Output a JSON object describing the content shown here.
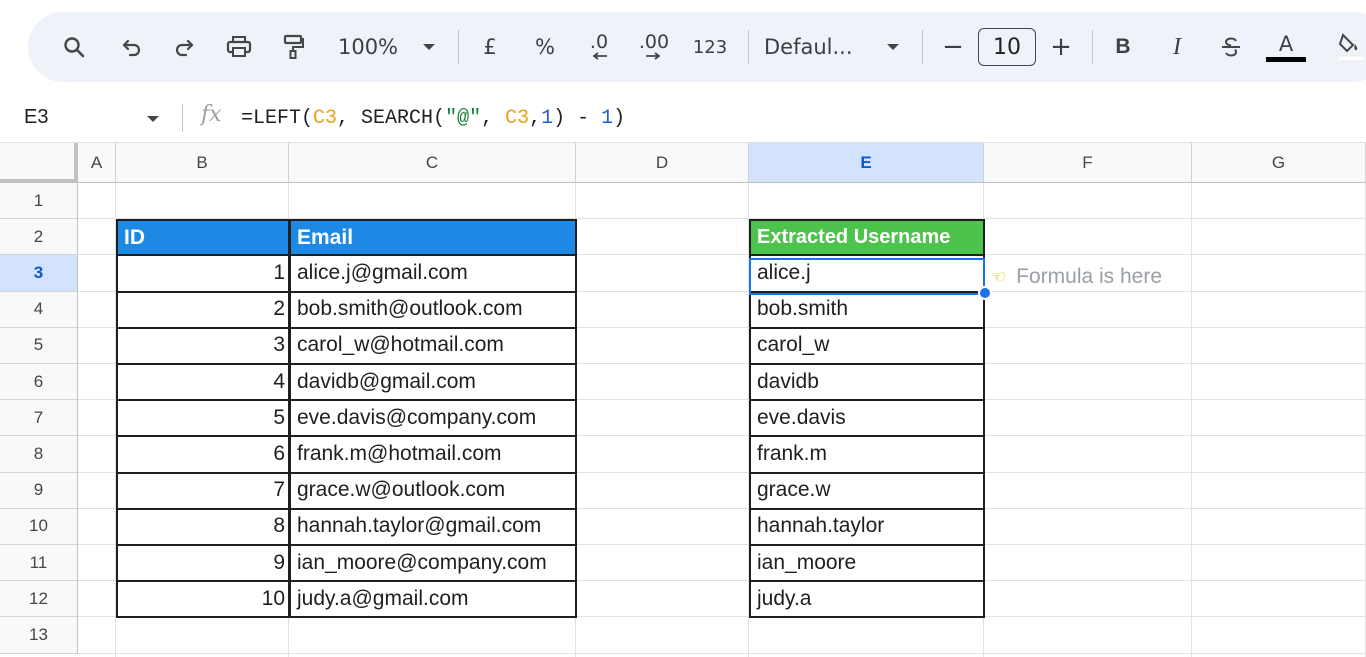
{
  "toolbar": {
    "zoom": "100%",
    "currency": "£",
    "percent": "%",
    "decrease_decimal": ".0",
    "increase_decimal": ".00",
    "number_format": "123",
    "font_name": "Defaul...",
    "font_size": "10",
    "minus": "−",
    "plus": "+",
    "bold": "B",
    "italic": "I",
    "text_color": "A"
  },
  "formula_bar": {
    "cell_ref": "E3",
    "fx": "fx",
    "formula_parts": [
      "=LEFT(",
      "C3",
      ", SEARCH(",
      "\"@\"",
      ", ",
      "C3",
      ",",
      "1",
      ") - ",
      "1",
      ")"
    ]
  },
  "columns": [
    "A",
    "B",
    "C",
    "D",
    "E",
    "F",
    "G"
  ],
  "rows": [
    "1",
    "2",
    "3",
    "4",
    "5",
    "6",
    "7",
    "8",
    "9",
    "10",
    "11",
    "12",
    "13"
  ],
  "selected_column": "E",
  "selected_row": "3",
  "table": {
    "headers": {
      "id": "ID",
      "email": "Email",
      "username": "Extracted Username"
    },
    "rows": [
      {
        "id": "1",
        "email": "alice.j@gmail.com",
        "username": "alice.j"
      },
      {
        "id": "2",
        "email": "bob.smith@outlook.com",
        "username": "bob.smith"
      },
      {
        "id": "3",
        "email": "carol_w@hotmail.com",
        "username": "carol_w"
      },
      {
        "id": "4",
        "email": "davidb@gmail.com",
        "username": "davidb"
      },
      {
        "id": "5",
        "email": "eve.davis@company.com",
        "username": "eve.davis"
      },
      {
        "id": "6",
        "email": "frank.m@hotmail.com",
        "username": "frank.m"
      },
      {
        "id": "7",
        "email": "grace.w@outlook.com",
        "username": "grace.w"
      },
      {
        "id": "8",
        "email": "hannah.taylor@gmail.com",
        "username": "hannah.taylor"
      },
      {
        "id": "9",
        "email": "ian_moore@company.com",
        "username": "ian_moore"
      },
      {
        "id": "10",
        "email": "judy.a@gmail.com",
        "username": "judy.a"
      }
    ]
  },
  "note": {
    "icon": "pointing-hand-icon",
    "text": "Formula is here"
  },
  "colors": {
    "header_blue": "#1e88e5",
    "header_green": "#4cc44c",
    "selection": "#1a73e8"
  }
}
